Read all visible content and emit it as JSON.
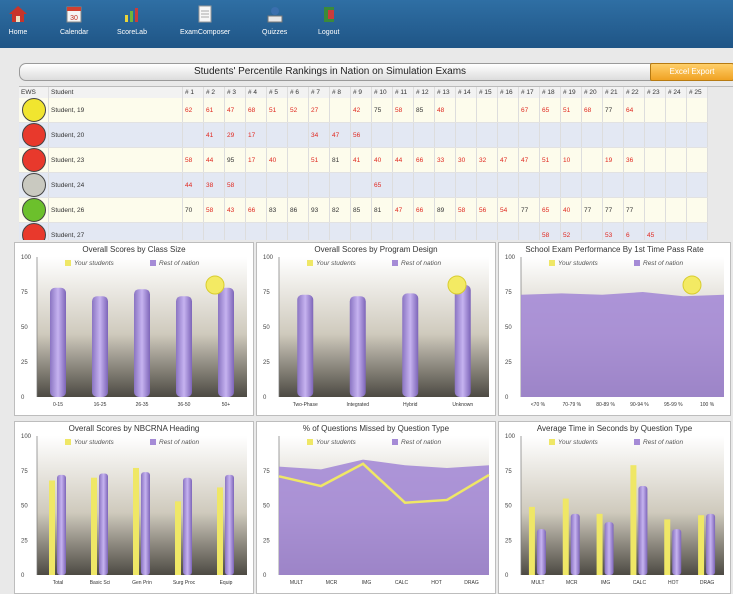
{
  "nav": [
    {
      "label": "Home",
      "icon": "home-icon"
    },
    {
      "label": "Calendar",
      "icon": "calendar-icon"
    },
    {
      "label": "ScoreLab",
      "icon": "scorelab-icon"
    },
    {
      "label": "ExamComposer",
      "icon": "document-icon"
    },
    {
      "label": "Quizzes",
      "icon": "quiz-icon"
    },
    {
      "label": "Logout",
      "icon": "logout-icon"
    }
  ],
  "title": "Students' Percentile Rankings in Nation on Simulation Exams",
  "export_label": "Excel Export",
  "table": {
    "headers": [
      "EWS",
      "Student",
      "# 1",
      "# 2",
      "# 3",
      "# 4",
      "# 5",
      "# 6",
      "# 7",
      "# 8",
      "# 9",
      "# 10",
      "# 11",
      "# 12",
      "# 13",
      "# 14",
      "# 15",
      "# 16",
      "# 17",
      "# 18",
      "# 19",
      "# 20",
      "# 21",
      "# 22",
      "# 23",
      "# 24",
      "# 25"
    ],
    "rows": [
      {
        "ews": "#f1e52f",
        "name": "Student, 19",
        "cells": [
          "62",
          "61",
          "47",
          "68",
          "51",
          "52",
          "27",
          "",
          "42",
          "75",
          "58",
          "85",
          "48",
          "",
          "",
          "",
          "67",
          "65",
          "51",
          "68",
          "77",
          "64",
          "",
          "",
          ""
        ]
      },
      {
        "ews": "#e8392c",
        "name": "Student, 20",
        "cells": [
          "",
          "41",
          "29",
          "17",
          "",
          "",
          "34",
          "47",
          "56",
          "",
          "",
          "",
          "",
          "",
          "",
          "",
          "",
          "",
          "",
          "",
          "",
          "",
          "",
          "",
          ""
        ]
      },
      {
        "ews": "#e8392c",
        "name": "Student, 23",
        "cells": [
          "58",
          "44",
          "95",
          "17",
          "40",
          "",
          "51",
          "81",
          "41",
          "40",
          "44",
          "66",
          "33",
          "30",
          "32",
          "47",
          "47",
          "51",
          "10",
          "",
          "19",
          "36",
          "",
          "",
          ""
        ]
      },
      {
        "ews": "#c9c9c0",
        "name": "Student, 24",
        "cells": [
          "44",
          "38",
          "58",
          "",
          "",
          "",
          "",
          "",
          "",
          "65",
          "",
          "",
          "",
          "",
          "",
          "",
          "",
          "",
          "",
          "",
          "",
          "",
          "",
          "",
          ""
        ]
      },
      {
        "ews": "#6cc02c",
        "name": "Student, 26",
        "cells": [
          "70",
          "58",
          "43",
          "66",
          "83",
          "86",
          "93",
          "82",
          "85",
          "81",
          "47",
          "66",
          "89",
          "58",
          "56",
          "54",
          "77",
          "65",
          "40",
          "77",
          "77",
          "77",
          "",
          "",
          ""
        ]
      },
      {
        "ews": "#e8392c",
        "name": "Student, 27",
        "cells": [
          "",
          "",
          "",
          "",
          "",
          "",
          "",
          "",
          "",
          "",
          "",
          "",
          "",
          "",
          "",
          "",
          "",
          "58",
          "52",
          "",
          "53",
          "6",
          "45",
          "",
          ""
        ]
      }
    ]
  },
  "charts": [
    {
      "title": "Overall Scores by Class Size",
      "legend": [
        "Your students",
        "Rest of nation"
      ]
    },
    {
      "title": "Overall Scores by Program Design",
      "legend": [
        "Your students",
        "Rest of nation"
      ]
    },
    {
      "title": "School Exam Performance By 1st Time Pass Rate",
      "legend": [
        "Your students",
        "Rest of nation"
      ]
    },
    {
      "title": "Overall Scores by NBCRNA Heading",
      "legend": [
        "Your students",
        "Rest of nation"
      ]
    },
    {
      "title": "% of Questions Missed by Question Type",
      "legend": [
        "Your students",
        "Rest of nation"
      ]
    },
    {
      "title": "Average Time in Seconds by Question Type",
      "legend": [
        "Your students",
        "Rest of nation"
      ]
    }
  ],
  "chart_data": [
    {
      "type": "bar",
      "title": "Overall Scores by Class Size",
      "categories": [
        "0-15",
        "16-25",
        "26-35",
        "36-50",
        "50+"
      ],
      "series": [
        {
          "name": "Your students",
          "values": [
            null,
            null,
            null,
            null,
            null
          ]
        },
        {
          "name": "Rest of nation",
          "values": [
            78,
            72,
            77,
            72,
            78
          ]
        }
      ],
      "ylim": [
        0,
        100
      ],
      "yticks": [
        0,
        25,
        50,
        75,
        100
      ]
    },
    {
      "type": "bar",
      "title": "Overall Scores by Program Design",
      "categories": [
        "Two-Phase",
        "Integrated",
        "Hybrid",
        "Unknown"
      ],
      "series": [
        {
          "name": "Your students",
          "values": [
            null,
            null,
            null,
            null
          ]
        },
        {
          "name": "Rest of nation",
          "values": [
            73,
            72,
            74,
            80
          ]
        }
      ],
      "ylim": [
        0,
        100
      ],
      "yticks": [
        0,
        25,
        50,
        75,
        100
      ]
    },
    {
      "type": "area",
      "title": "School Exam Performance By 1st Time Pass Rate",
      "categories": [
        "<70 %",
        "70-79 %",
        "80-89 %",
        "90-94 %",
        "95-99 %",
        "100 %"
      ],
      "series": [
        {
          "name": "Your students",
          "values": [
            null,
            null,
            null,
            null,
            null,
            null
          ]
        },
        {
          "name": "Rest of nation",
          "values": [
            73,
            74,
            73,
            75,
            72,
            73
          ]
        }
      ],
      "ylim": [
        0,
        100
      ],
      "yticks": [
        0,
        25,
        50,
        75,
        100
      ]
    },
    {
      "type": "bar",
      "title": "Overall Scores by NBCRNA Heading",
      "categories": [
        "Total",
        "Basic Sci",
        "Gen Prin",
        "Surg Proc",
        "Equip"
      ],
      "series": [
        {
          "name": "Your students",
          "values": [
            68,
            70,
            77,
            53,
            63
          ]
        },
        {
          "name": "Rest of nation",
          "values": [
            72,
            73,
            74,
            70,
            72
          ]
        }
      ],
      "ylim": [
        0,
        100
      ],
      "yticks": [
        0,
        25,
        50,
        75,
        100
      ]
    },
    {
      "type": "area",
      "title": "% of Questions Missed by Question Type",
      "categories": [
        "MULT",
        "MCR",
        "IMG",
        "CALC",
        "HOT",
        "DRAG"
      ],
      "series": [
        {
          "name": "Your students",
          "values": [
            71,
            64,
            80,
            52,
            54,
            72
          ]
        },
        {
          "name": "Rest of nation",
          "values": [
            78,
            76,
            83,
            79,
            77,
            79
          ]
        }
      ],
      "ylim": [
        0,
        100
      ],
      "yticks": [
        0,
        25,
        50,
        75
      ]
    },
    {
      "type": "bar",
      "title": "Average Time in Seconds by Question Type",
      "categories": [
        "MULT",
        "MCR",
        "IMG",
        "CALC",
        "HOT",
        "DRAG"
      ],
      "series": [
        {
          "name": "Your students",
          "values": [
            49,
            55,
            44,
            79,
            40,
            43
          ]
        },
        {
          "name": "Rest of nation",
          "values": [
            33,
            44,
            38,
            64,
            33,
            44
          ]
        }
      ],
      "ylim": [
        0,
        100
      ],
      "yticks": [
        0,
        25,
        50,
        75,
        100
      ]
    }
  ],
  "colors": {
    "nav_bg": "#2364a0",
    "yours": "#efe766",
    "nation": "#a58bd6",
    "red": "#e0281f"
  }
}
